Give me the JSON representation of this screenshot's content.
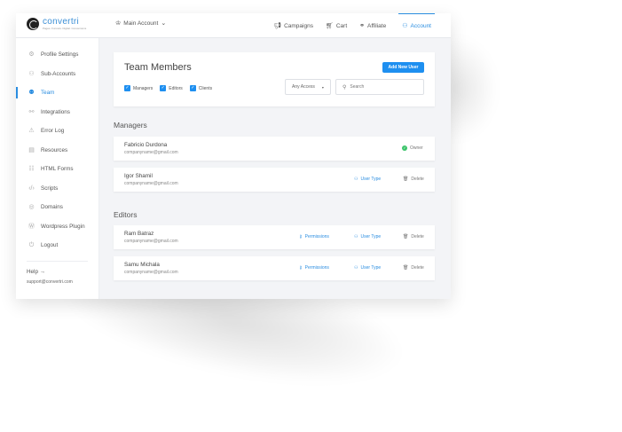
{
  "brand": {
    "name": "convertri",
    "tagline": "Pages. Funnels. Digital. Conversions"
  },
  "topbar": {
    "main_account": "Main Account",
    "nav": [
      {
        "label": "Campaigns",
        "icon": "megaphone-icon"
      },
      {
        "label": "Cart",
        "icon": "cart-icon"
      },
      {
        "label": "Affiliate",
        "icon": "handshake-icon"
      },
      {
        "label": "Account",
        "icon": "user-icon",
        "active": true
      }
    ]
  },
  "sidebar": {
    "items": [
      {
        "label": "Profile Settings",
        "icon": "gear-icon"
      },
      {
        "label": "Sub-Accounts",
        "icon": "user-icon"
      },
      {
        "label": "Team",
        "icon": "team-icon",
        "active": true
      },
      {
        "label": "Integrations",
        "icon": "link-icon"
      },
      {
        "label": "Error Log",
        "icon": "warning-icon"
      },
      {
        "label": "Resources",
        "icon": "book-icon"
      },
      {
        "label": "HTML Forms",
        "icon": "form-icon"
      },
      {
        "label": "Scripts",
        "icon": "code-icon"
      },
      {
        "label": "Domains",
        "icon": "globe-icon"
      },
      {
        "label": "Wordpress Plugin",
        "icon": "wordpress-icon"
      },
      {
        "label": "Logout",
        "icon": "power-icon"
      }
    ],
    "help": "Help",
    "support_email": "support@convertri.com"
  },
  "main": {
    "title": "Team Members",
    "add_user_label": "Add New User",
    "filters": [
      {
        "label": "Managers",
        "checked": true
      },
      {
        "label": "Editors",
        "checked": true
      },
      {
        "label": "Clients",
        "checked": true
      }
    ],
    "access_select": "Any Access",
    "search_placeholder": "Search",
    "sections": [
      {
        "title": "Managers",
        "members": [
          {
            "name": "Fabricio Durdona",
            "email": "companyname@gmail.com",
            "owner_label": "Owner"
          },
          {
            "name": "Igor Shamil",
            "email": "companyname@gmail.com",
            "user_type": "User Type",
            "delete": "Delete"
          }
        ]
      },
      {
        "title": "Editors",
        "members": [
          {
            "name": "Ram Batraz",
            "email": "companyname@gmail.com",
            "permissions": "Permissions",
            "user_type": "User Type",
            "delete": "Delete"
          },
          {
            "name": "Samu Michala",
            "email": "companyname@gmail.com",
            "permissions": "Permissions",
            "user_type": "User Type",
            "delete": "Delete"
          }
        ]
      }
    ]
  },
  "colors": {
    "accent": "#2a8de0",
    "button": "#1e8ff0",
    "owner": "#3cc46b"
  }
}
